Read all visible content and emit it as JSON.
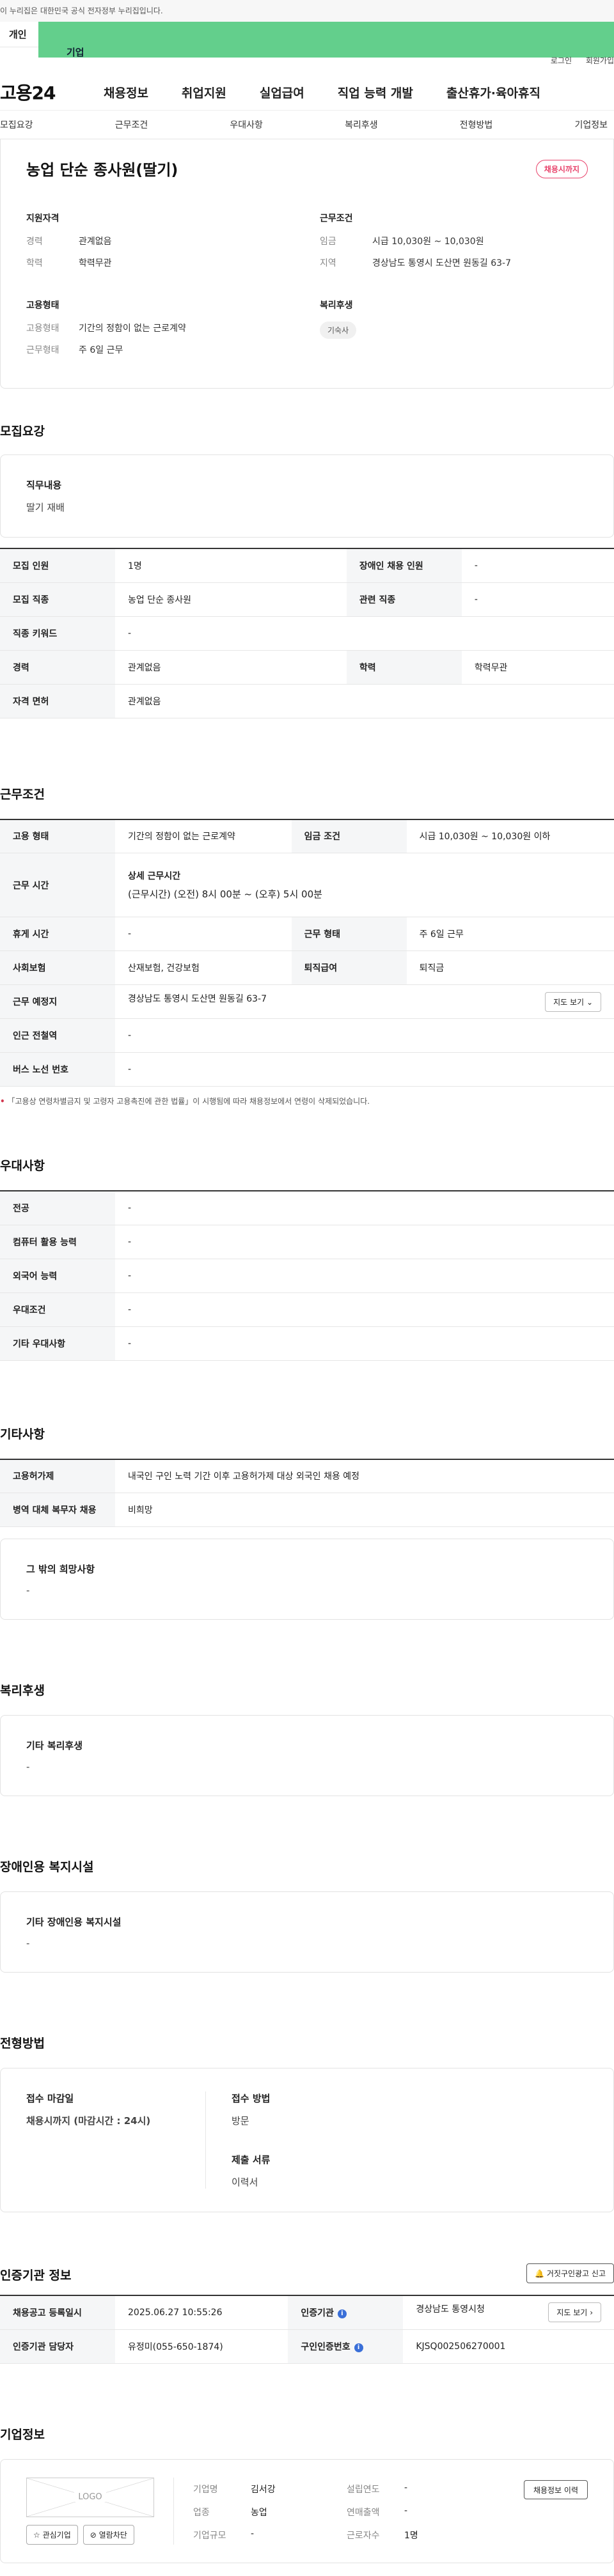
{
  "banner": {
    "text": "이 누리집은 대한민국 공식 전자정부 누리집입니다."
  },
  "user_tabs": {
    "person": "개인",
    "company": "기업"
  },
  "util": {
    "login": "로그인",
    "signup": "회원가입"
  },
  "gnb": {
    "logo": "고용24",
    "menus": [
      "채용정보",
      "취업지원",
      "실업급여",
      "직업 능력 개발",
      "출산휴가·육아휴직"
    ]
  },
  "subnav": [
    "모집요강",
    "근무조건",
    "우대사항",
    "복리후생",
    "전형방법",
    "기업정보"
  ],
  "summary": {
    "title": "농업 단순 종사원(딸기)",
    "status": "채용시까지",
    "qual_title": "지원자격",
    "career_k": "경력",
    "career_v": "관계없음",
    "edu_k": "학력",
    "edu_v": "학력무관",
    "cond_title": "근무조건",
    "wage_k": "임금",
    "wage_v": "시급 10,030원 ~ 10,030원",
    "region_k": "지역",
    "region_v": "경상남도 통영시 도산면 원동길 63-7",
    "emp_title": "고용형태",
    "emptype_k": "고용형태",
    "emptype_v": "기간의 정함이 없는 근로계약",
    "workform_k": "근무형태",
    "workform_v": "주 6일 근무",
    "welfare_title": "복리후생",
    "welfare_tag": "기숙사"
  },
  "recruit": {
    "title": "모집요강",
    "duty_title": "직무내용",
    "duty_text": "딸기 재배",
    "rows": {
      "count_k": "모집 인원",
      "count_v": "1명",
      "disabled_k": "장애인 채용 인원",
      "disabled_v": "-",
      "job_k": "모집 직종",
      "job_v": "농업 단순 종사원",
      "related_k": "관련 직종",
      "related_v": "-",
      "keyword_k": "직종 키워드",
      "keyword_v": "-",
      "career_k": "경력",
      "career_v": "관계없음",
      "edu_k": "학력",
      "edu_v": "학력무관",
      "license_k": "자격 면허",
      "license_v": "관계없음"
    }
  },
  "work": {
    "title": "근무조건",
    "emptype_k": "고용 형태",
    "emptype_v": "기간의 정함이 없는 근로계약",
    "wage_k": "임금 조건",
    "wage_v": "시급 10,030원 ~ 10,030원 이하",
    "hours_k": "근무 시간",
    "hours_sub": "상세 근무시간",
    "hours_v": "(근무시간) (오전) 8시 00분 ~ (오후) 5시 00분",
    "rest_k": "휴게 시간",
    "rest_v": "-",
    "form_k": "근무 형태",
    "form_v": "주 6일 근무",
    "insurance_k": "사회보험",
    "insurance_v": "산재보험, 건강보험",
    "retire_k": "퇴직급여",
    "retire_v": "퇴직금",
    "place_k": "근무 예정지",
    "place_v": "경상남도 통영시 도산면 원동길 63-7",
    "map_btn": "지도 보기",
    "station_k": "인근 전철역",
    "station_v": "-",
    "bus_k": "버스 노선 번호",
    "bus_v": "-",
    "note": "「고용상 연령차별금지 및 고령자 고용촉진에 관한 법률」이 시행됨에 따라 채용정보에서 연령이 삭제되었습니다."
  },
  "pref": {
    "title": "우대사항",
    "major_k": "전공",
    "major_v": "-",
    "computer_k": "컴퓨터 활용 능력",
    "computer_v": "-",
    "lang_k": "외국어 능력",
    "lang_v": "-",
    "cond_k": "우대조건",
    "cond_v": "-",
    "etc_k": "기타 우대사항",
    "etc_v": "-"
  },
  "other": {
    "title": "기타사항",
    "permit_k": "고용허가제",
    "permit_v": "내국인 구인 노력 기간 이후 고용허가제 대상 외국인 채용 예정",
    "military_k": "병역 대체 복무자 채용",
    "military_v": "비희망",
    "wish_title": "그 밖의 희망사항",
    "wish_text": "-"
  },
  "benefit": {
    "title": "복리후생",
    "sub_title": "기타 복리후생",
    "text": "-"
  },
  "facility": {
    "title": "장애인용 복지시설",
    "sub_title": "기타 장애인용 복지시설",
    "text": "-"
  },
  "process": {
    "title": "전형방법",
    "deadline_title": "접수 마감일",
    "deadline_v": "채용시까지 (마감시간 : 24시)",
    "method_title": "접수 방법",
    "method_v": "방문",
    "docs_title": "제출 서류",
    "docs_v": "이력서"
  },
  "cert": {
    "title": "인증기관 정보",
    "report_btn": "거짓구인광고 신고",
    "reg_k": "채용공고 등록일시",
    "reg_v": "2025.06.27 10:55:26",
    "agency_k": "인증기관",
    "agency_v": "경상남도 통영시청",
    "map_btn": "지도 보기",
    "manager_k": "인증기관 담당자",
    "manager_v": "유정미(055-650-1874)",
    "auth_k": "구인인증번호",
    "auth_v": "KJSQ002506270001"
  },
  "company": {
    "title": "기업정보",
    "logo": "LOGO",
    "fav_btn": "관심기업",
    "block_btn": "열람차단",
    "name_k": "기업명",
    "name_v": "김서강",
    "year_k": "설립연도",
    "year_v": "-",
    "industry_k": "업종",
    "industry_v": "농업",
    "sales_k": "연매출액",
    "sales_v": "-",
    "size_k": "기업규모",
    "size_v": "-",
    "staff_k": "근로자수",
    "staff_v": "1명",
    "history_btn": "채용정보 이력"
  }
}
